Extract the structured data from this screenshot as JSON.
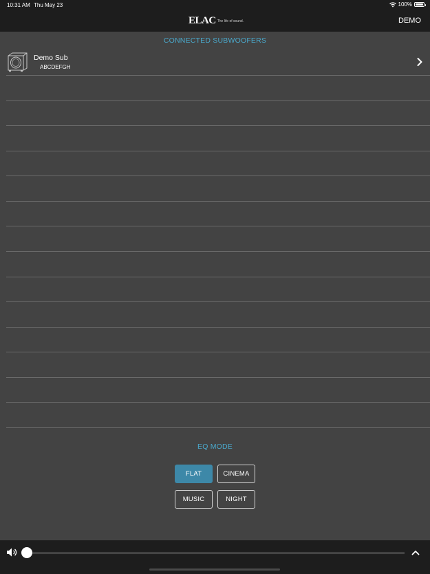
{
  "status_bar": {
    "time": "10:31 AM",
    "date": "Thu May 23",
    "battery_level": "100%",
    "icons": [
      "wifi-icon",
      "battery-icon"
    ]
  },
  "nav": {
    "logo_mark": "ELAC",
    "logo_tagline": "The life of sound.",
    "demo_label": "DEMO"
  },
  "subwoofers": {
    "section_title": "CONNECTED SUBWOOFERS",
    "devices": [
      {
        "name": "Demo Sub",
        "serial": "ABCDEFGH",
        "icon": "subwoofer-icon"
      }
    ]
  },
  "eq": {
    "section_title": "EQ MODE",
    "modes": [
      {
        "label": "FLAT",
        "active": true
      },
      {
        "label": "CINEMA",
        "active": false
      },
      {
        "label": "MUSIC",
        "active": false
      },
      {
        "label": "NIGHT",
        "active": false
      }
    ]
  },
  "volume": {
    "level": 0,
    "icons": [
      "speaker-icon",
      "chevron-up-icon"
    ]
  },
  "colors": {
    "accent": "#4aa9cc",
    "active_button": "#3d88a8",
    "background": "#434343",
    "bars": "#1d1d1d"
  }
}
